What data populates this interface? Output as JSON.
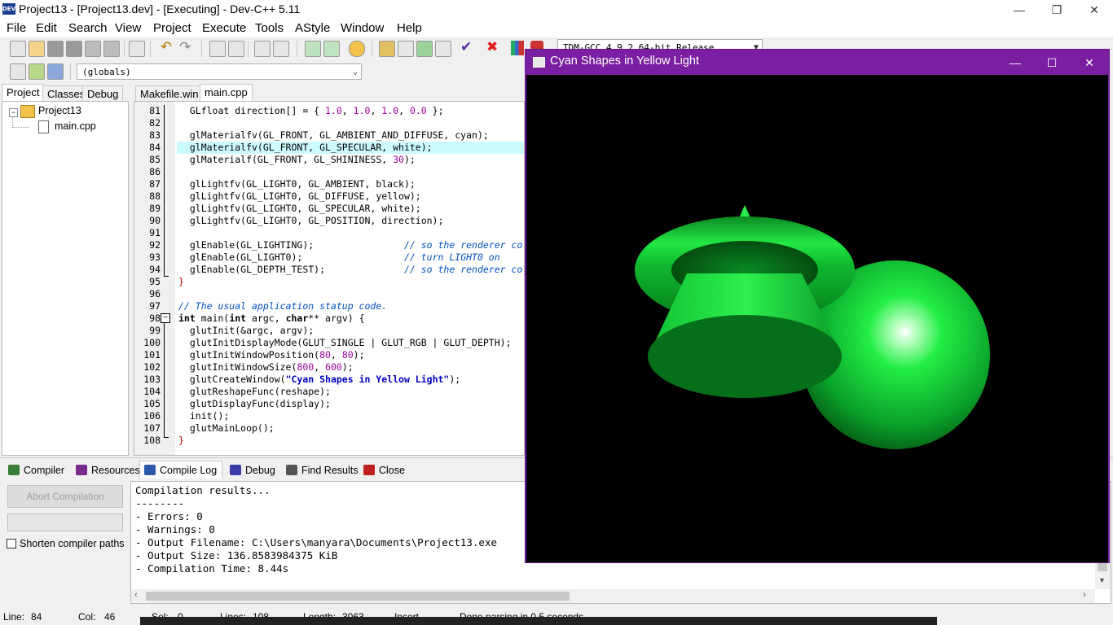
{
  "window": {
    "title": "Project13 - [Project13.dev] - [Executing] - Dev-C++ 5.11",
    "icon_text": "DEV",
    "controls": [
      "—",
      "❐",
      "✕"
    ]
  },
  "menu": [
    "File",
    "Edit",
    "Search",
    "View",
    "Project",
    "Execute",
    "Tools",
    "AStyle",
    "Window",
    "Help"
  ],
  "toolbar": {
    "compiler_select": "TDM-GCC 4.9.2 64-bit Release",
    "scope_select": "(globals)"
  },
  "left_panel": {
    "tabs": [
      "Project",
      "Classes",
      "Debug"
    ],
    "active_tab": "Project",
    "tree": {
      "project": "Project13",
      "files": [
        "main.cpp"
      ]
    }
  },
  "editor": {
    "tabs": [
      "Makefile.win",
      "main.cpp"
    ],
    "active_tab": "main.cpp",
    "highlighted_line": 84,
    "lines": [
      {
        "n": "81",
        "html": "  GLfloat direction[] = { <span class='num'>1.0</span>, <span class='num'>1.0</span>, <span class='num'>1.0</span>, <span class='num'>0.0</span> };"
      },
      {
        "n": "82",
        "html": ""
      },
      {
        "n": "83",
        "html": "  glMaterialfv(GL_FRONT, GL_AMBIENT_AND_DIFFUSE, cyan);"
      },
      {
        "n": "84",
        "html": "  glMaterialfv(GL_FRONT, GL_SPECULAR, white);"
      },
      {
        "n": "85",
        "html": "  glMaterialf(GL_FRONT, GL_SHININESS, <span class='num'>30</span>);"
      },
      {
        "n": "86",
        "html": ""
      },
      {
        "n": "87",
        "html": "  glLightfv(GL_LIGHT0, GL_AMBIENT, black);"
      },
      {
        "n": "88",
        "html": "  glLightfv(GL_LIGHT0, GL_DIFFUSE, yellow);"
      },
      {
        "n": "89",
        "html": "  glLightfv(GL_LIGHT0, GL_SPECULAR, white);"
      },
      {
        "n": "90",
        "html": "  glLightfv(GL_LIGHT0, GL_POSITION, direction);"
      },
      {
        "n": "91",
        "html": ""
      },
      {
        "n": "92",
        "html": "  glEnable(GL_LIGHTING);                <span class='cmt'>// so the renderer co</span>"
      },
      {
        "n": "93",
        "html": "  glEnable(GL_LIGHT0);                  <span class='cmt'>// turn LIGHT0 on</span>"
      },
      {
        "n": "94",
        "html": "  glEnable(GL_DEPTH_TEST);              <span class='cmt'>// so the renderer co</span>"
      },
      {
        "n": "95",
        "html": "<span class='red'>}</span>"
      },
      {
        "n": "96",
        "html": ""
      },
      {
        "n": "97",
        "html": "<span class='cmt'>// The usual application statup code.</span>"
      },
      {
        "n": "98",
        "html": "<span class='kw'>int</span> main(<span class='kw'>int</span> argc, <span class='kw'>char</span>** argv) {"
      },
      {
        "n": "99",
        "html": "  glutInit(&amp;argc, argv);"
      },
      {
        "n": "100",
        "html": "  glutInitDisplayMode(GLUT_SINGLE | GLUT_RGB | GLUT_DEPTH);"
      },
      {
        "n": "101",
        "html": "  glutInitWindowPosition(<span class='num'>80</span>, <span class='num'>80</span>);"
      },
      {
        "n": "102",
        "html": "  glutInitWindowSize(<span class='num'>800</span>, <span class='num'>600</span>);"
      },
      {
        "n": "103",
        "html": "  glutCreateWindow(<span class='str'>\"Cyan Shapes in Yellow Light\"</span>);"
      },
      {
        "n": "104",
        "html": "  glutReshapeFunc(reshape);"
      },
      {
        "n": "105",
        "html": "  glutDisplayFunc(display);"
      },
      {
        "n": "106",
        "html": "  init();"
      },
      {
        "n": "107",
        "html": "  glutMainLoop();"
      },
      {
        "n": "108",
        "html": "<span class='red'>}</span>"
      }
    ]
  },
  "bottom_panel": {
    "tabs": [
      {
        "label": "Compiler",
        "icon": "grid-icon",
        "color": "#3a7d3a"
      },
      {
        "label": "Resources",
        "icon": "resources-icon",
        "color": "#7a2a8a"
      },
      {
        "label": "Compile Log",
        "icon": "chart-icon",
        "color": "#2a5aa8"
      },
      {
        "label": "Debug",
        "icon": "check-icon",
        "color": "#3a3aa8"
      },
      {
        "label": "Find Results",
        "icon": "find-icon",
        "color": "#555555"
      },
      {
        "label": "Close",
        "icon": "close-icon",
        "color": "#c02020"
      }
    ],
    "active_tab": "Compile Log",
    "abort_button": "Abort Compilation",
    "shorten_paths_label": "Shorten compiler paths",
    "log_lines": [
      "Compilation results...",
      "--------",
      "- Errors: 0",
      "- Warnings: 0",
      "- Output Filename: C:\\Users\\manyara\\Documents\\Project13.exe",
      "- Output Size: 136.8583984375 KiB",
      "- Compilation Time: 8.44s"
    ]
  },
  "status_bar": {
    "line_label": "Line:",
    "line_value": "84",
    "col_label": "Col:",
    "col_value": "46",
    "sel_label": "Sel:",
    "sel_value": "0",
    "lines_label": "Lines:",
    "lines_value": "108",
    "length_label": "Length:",
    "length_value": "3063",
    "mode": "Insert",
    "message": "Done parsing in 0.5 seconds"
  },
  "gl_window": {
    "title": "Cyan Shapes in Yellow Light",
    "controls": [
      "—",
      "☐",
      "✕"
    ],
    "title_color": "#7b1fa2",
    "shape_color": "#00ff33"
  }
}
